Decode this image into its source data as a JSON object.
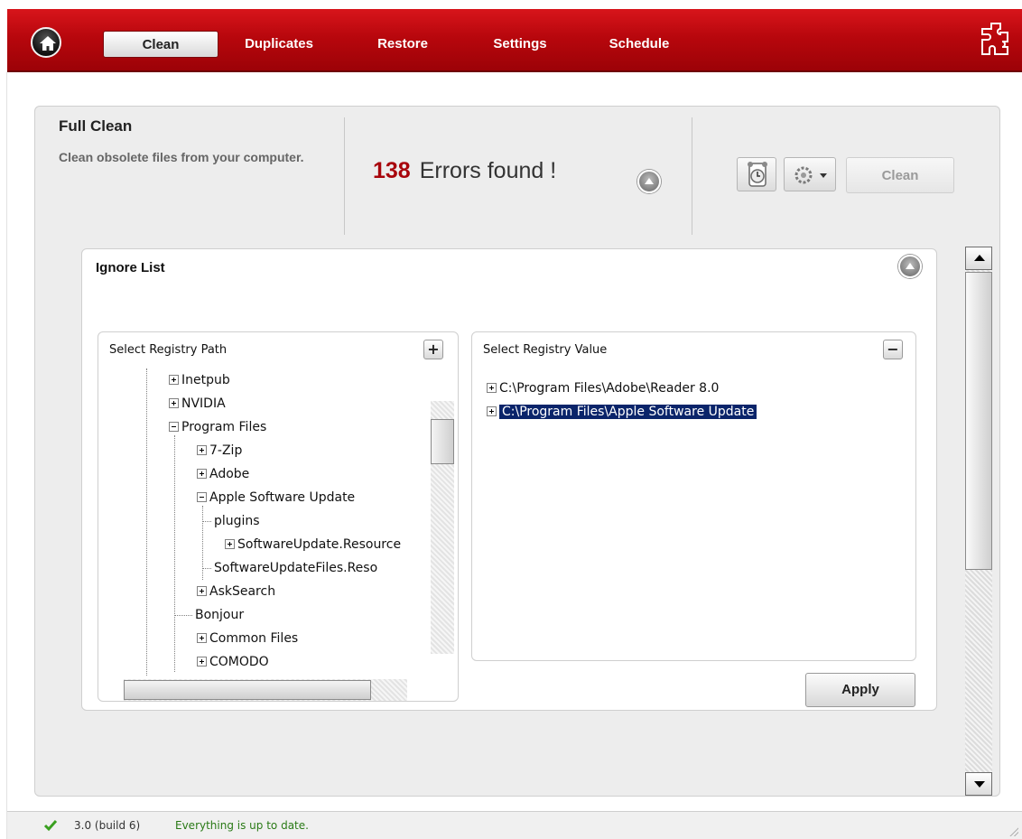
{
  "nav": {
    "tabs": [
      {
        "label": "Clean",
        "active": true
      },
      {
        "label": "Duplicates"
      },
      {
        "label": "Restore"
      },
      {
        "label": "Settings"
      },
      {
        "label": "Schedule"
      }
    ],
    "home_icon": "home-icon",
    "brand_icon": "puzzle-icon",
    "accent_color": "#c0070d"
  },
  "header": {
    "title": "Full Clean",
    "description": "Clean obsolete files from your computer.",
    "errors_count": "138",
    "errors_text": "Errors found !",
    "clean_button": "Clean",
    "alarm_icon": "alarm-clock-icon",
    "gear_icon": "gear-dropdown-icon"
  },
  "ignore_list": {
    "title": "Ignore List",
    "path_panel": {
      "title": "Select Registry Path",
      "add_button": "+",
      "tree": [
        {
          "label": "Inetpub",
          "expander": "plus"
        },
        {
          "label": "NVIDIA",
          "expander": "plus"
        },
        {
          "label": "Program Files",
          "expander": "minus"
        },
        {
          "label": "7-Zip",
          "expander": "plus"
        },
        {
          "label": "Adobe",
          "expander": "plus"
        },
        {
          "label": "Apple Software Update",
          "expander": "minus"
        },
        {
          "label": "plugins",
          "expander": "none"
        },
        {
          "label": "SoftwareUpdate.Resource",
          "expander": "plus"
        },
        {
          "label": "SoftwareUpdateFiles.Reso",
          "expander": "none"
        },
        {
          "label": "AskSearch",
          "expander": "plus"
        },
        {
          "label": "Bonjour",
          "expander": "none"
        },
        {
          "label": "Common Files",
          "expander": "plus"
        },
        {
          "label": "COMODO",
          "expander": "plus"
        }
      ]
    },
    "value_panel": {
      "title": "Select Registry Value",
      "remove_button": "−",
      "values": [
        {
          "label": "C:\\Program Files\\Adobe\\Reader 8.0",
          "selected": false
        },
        {
          "label": "C:\\Program Files\\Apple Software Update",
          "selected": true
        }
      ]
    },
    "apply_button": "Apply"
  },
  "status": {
    "icon": "check-icon",
    "version": "3.0 (build 6)",
    "message": "Everything is up to date."
  }
}
